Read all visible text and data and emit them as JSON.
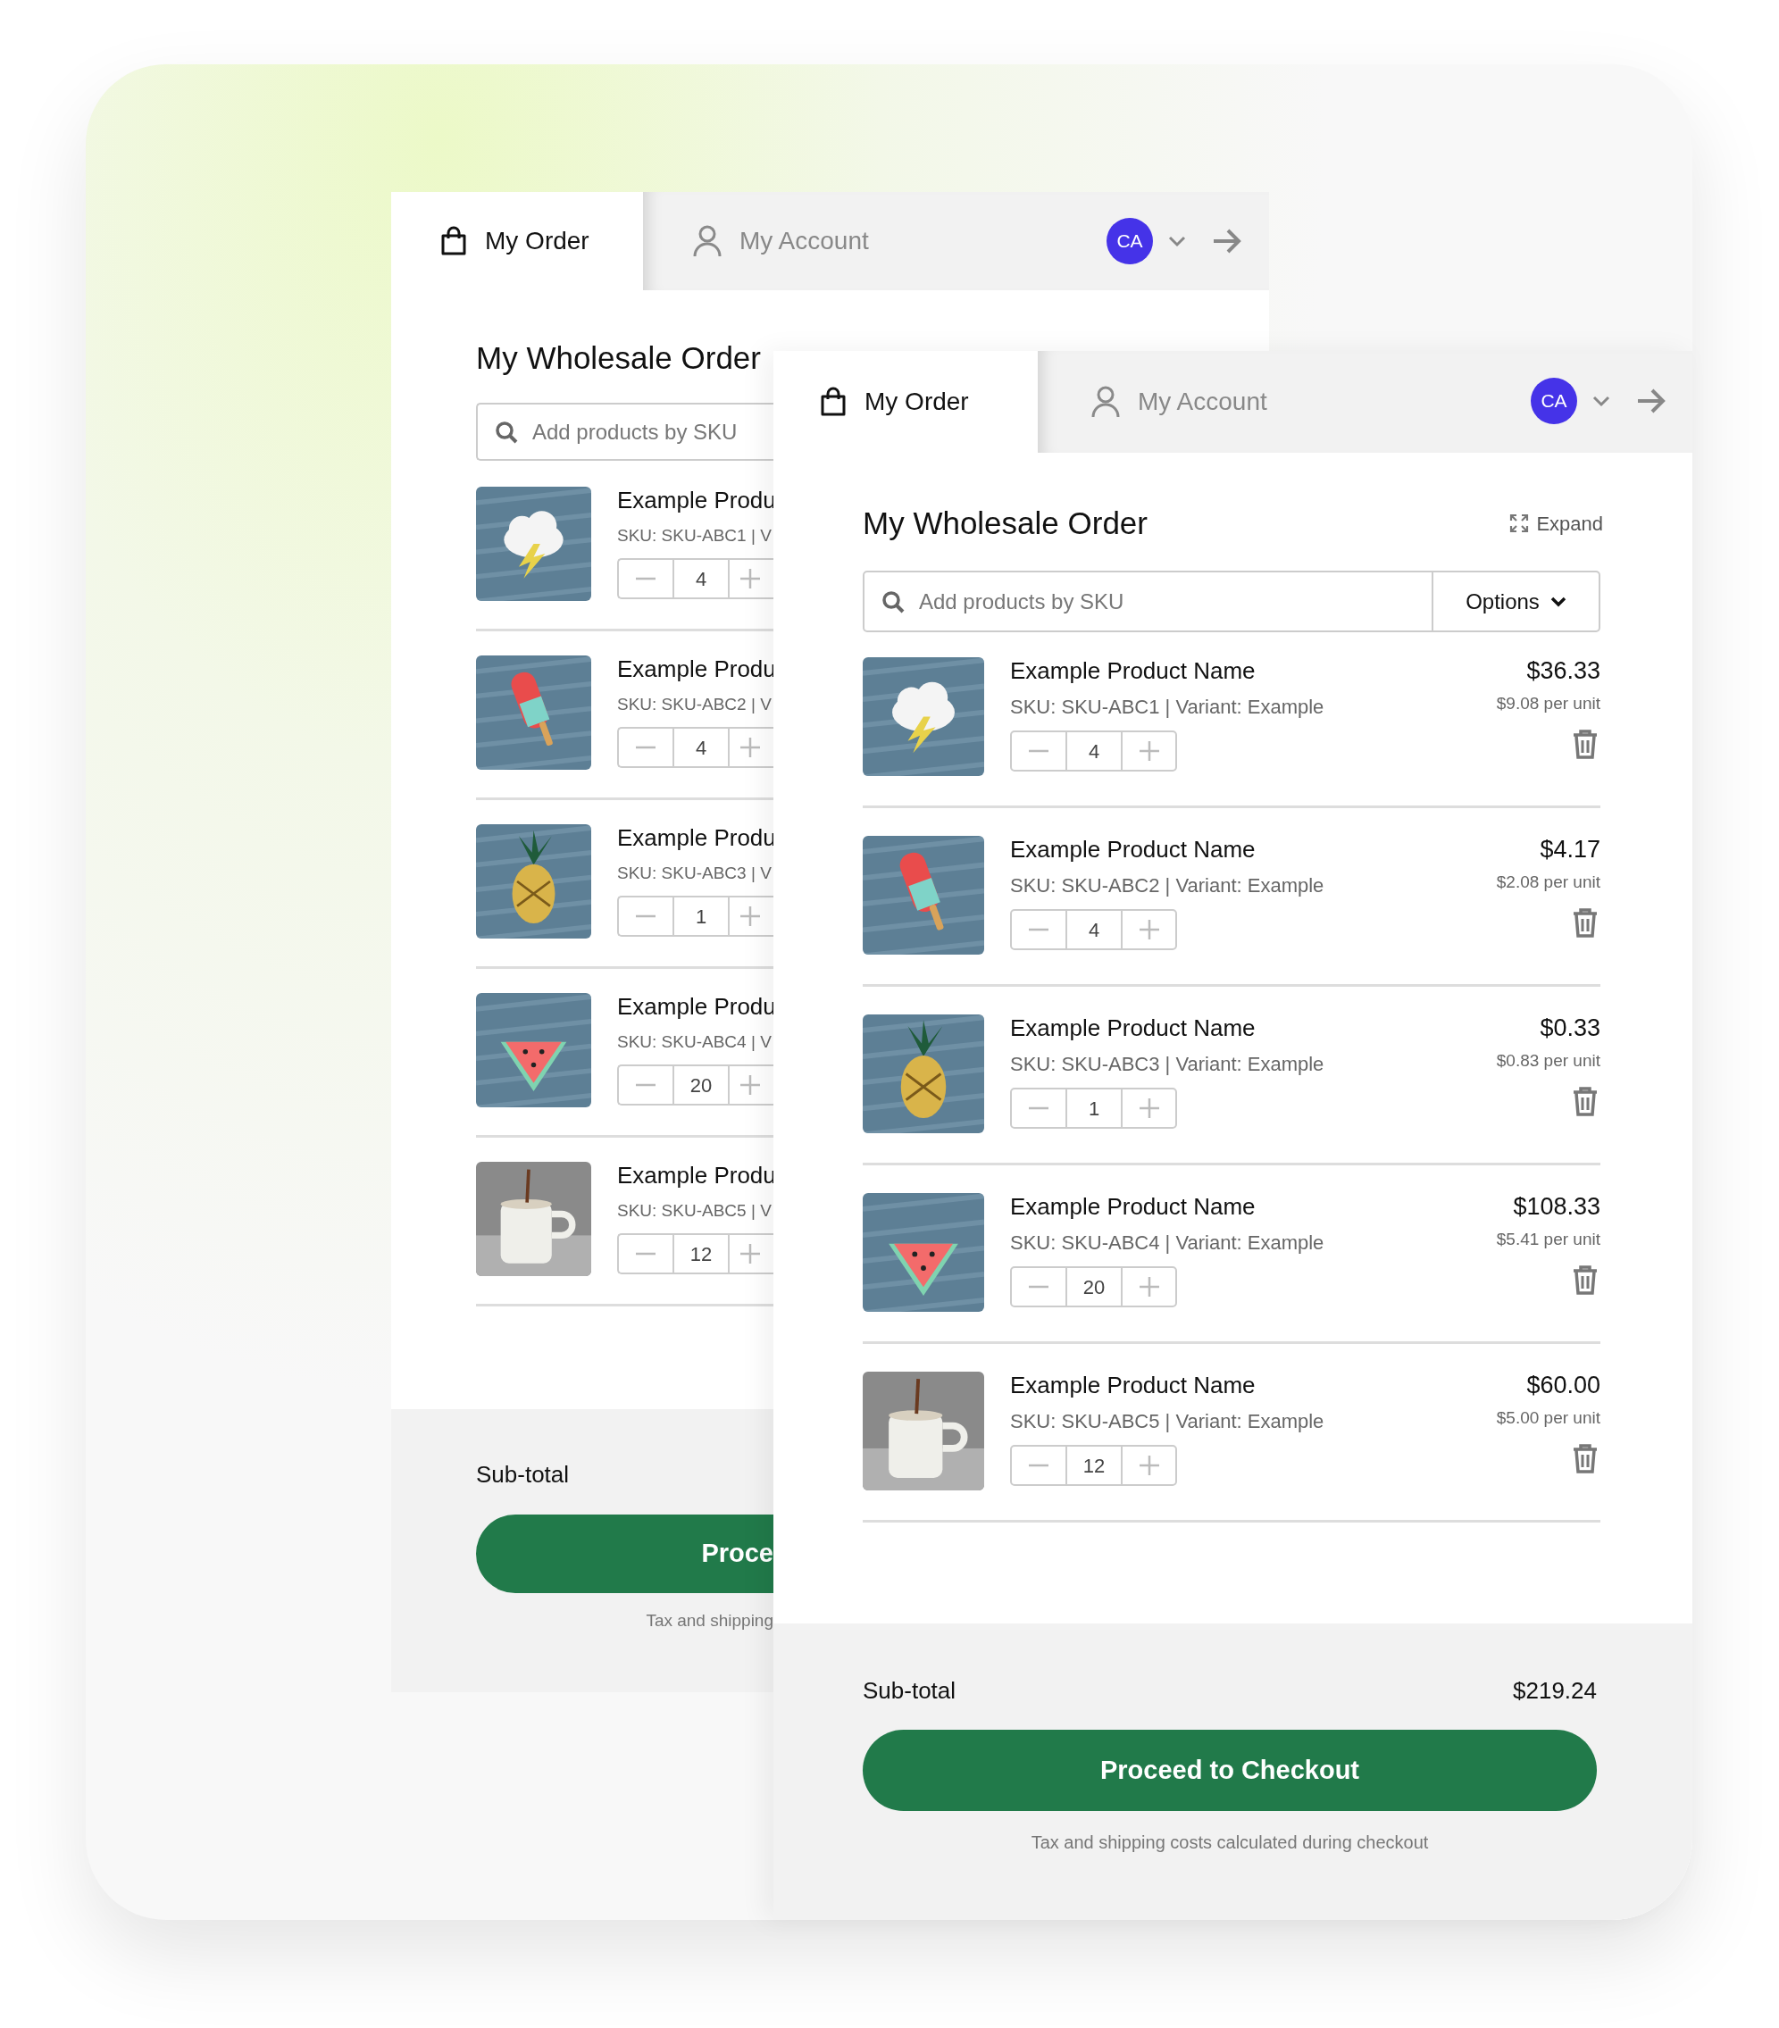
{
  "back_panel": {
    "tabs": [
      {
        "label": "My Order",
        "selected": true
      },
      {
        "label": "My Account",
        "selected": false
      }
    ],
    "avatar": "CA",
    "title": "My Wholesale Order",
    "search": {
      "placeholder": "Add products by SKU"
    },
    "items": [
      {
        "name": "Example Produ",
        "sku": "SKU: SKU-ABC1 | V",
        "quantity": "4"
      },
      {
        "name": "Example Produ",
        "sku": "SKU: SKU-ABC2 | V",
        "quantity": "4"
      },
      {
        "name": "Example Produ",
        "sku": "SKU: SKU-ABC3 | V",
        "quantity": "1"
      },
      {
        "name": "Example Produ",
        "sku": "SKU: SKU-ABC4 | V",
        "quantity": "20"
      },
      {
        "name": "Example Produ",
        "sku": "SKU: SKU-ABC5 | V",
        "quantity": "12"
      }
    ],
    "subtotal_label": "Sub-total",
    "checkout_button": "Proce",
    "note": "Tax and shipping"
  },
  "front_panel": {
    "tabs": [
      {
        "label": "My Order",
        "selected": true
      },
      {
        "label": "My Account",
        "selected": false
      }
    ],
    "avatar": "CA",
    "title": "My Wholesale Order",
    "expand": "Expand",
    "search": {
      "placeholder": "Add products by SKU"
    },
    "options": "Options",
    "items": [
      {
        "name": "Example Product Name",
        "sku": "SKU: SKU-ABC1 | Variant: Example",
        "quantity": "4",
        "price": "$36.33",
        "unit_price": "$9.08 per unit"
      },
      {
        "name": "Example Product Name",
        "sku": "SKU: SKU-ABC2 | Variant: Example",
        "quantity": "4",
        "price": "$4.17",
        "unit_price": "$2.08 per unit"
      },
      {
        "name": "Example Product Name",
        "sku": "SKU: SKU-ABC3 | Variant: Example",
        "quantity": "1",
        "price": "$0.33",
        "unit_price": "$0.83 per unit"
      },
      {
        "name": "Example Product Name",
        "sku": "SKU: SKU-ABC4 | Variant: Example",
        "quantity": "20",
        "price": "$108.33",
        "unit_price": "$5.41 per unit"
      },
      {
        "name": "Example Product Name",
        "sku": "SKU: SKU-ABC5 | Variant: Example",
        "quantity": "12",
        "price": "$60.00",
        "unit_price": "$5.00 per unit"
      }
    ],
    "subtotal_label": "Sub-total",
    "subtotal_value": "$219.24",
    "checkout_button": "Proceed to Checkout",
    "note": "Tax and shipping costs calculated during checkout"
  }
}
